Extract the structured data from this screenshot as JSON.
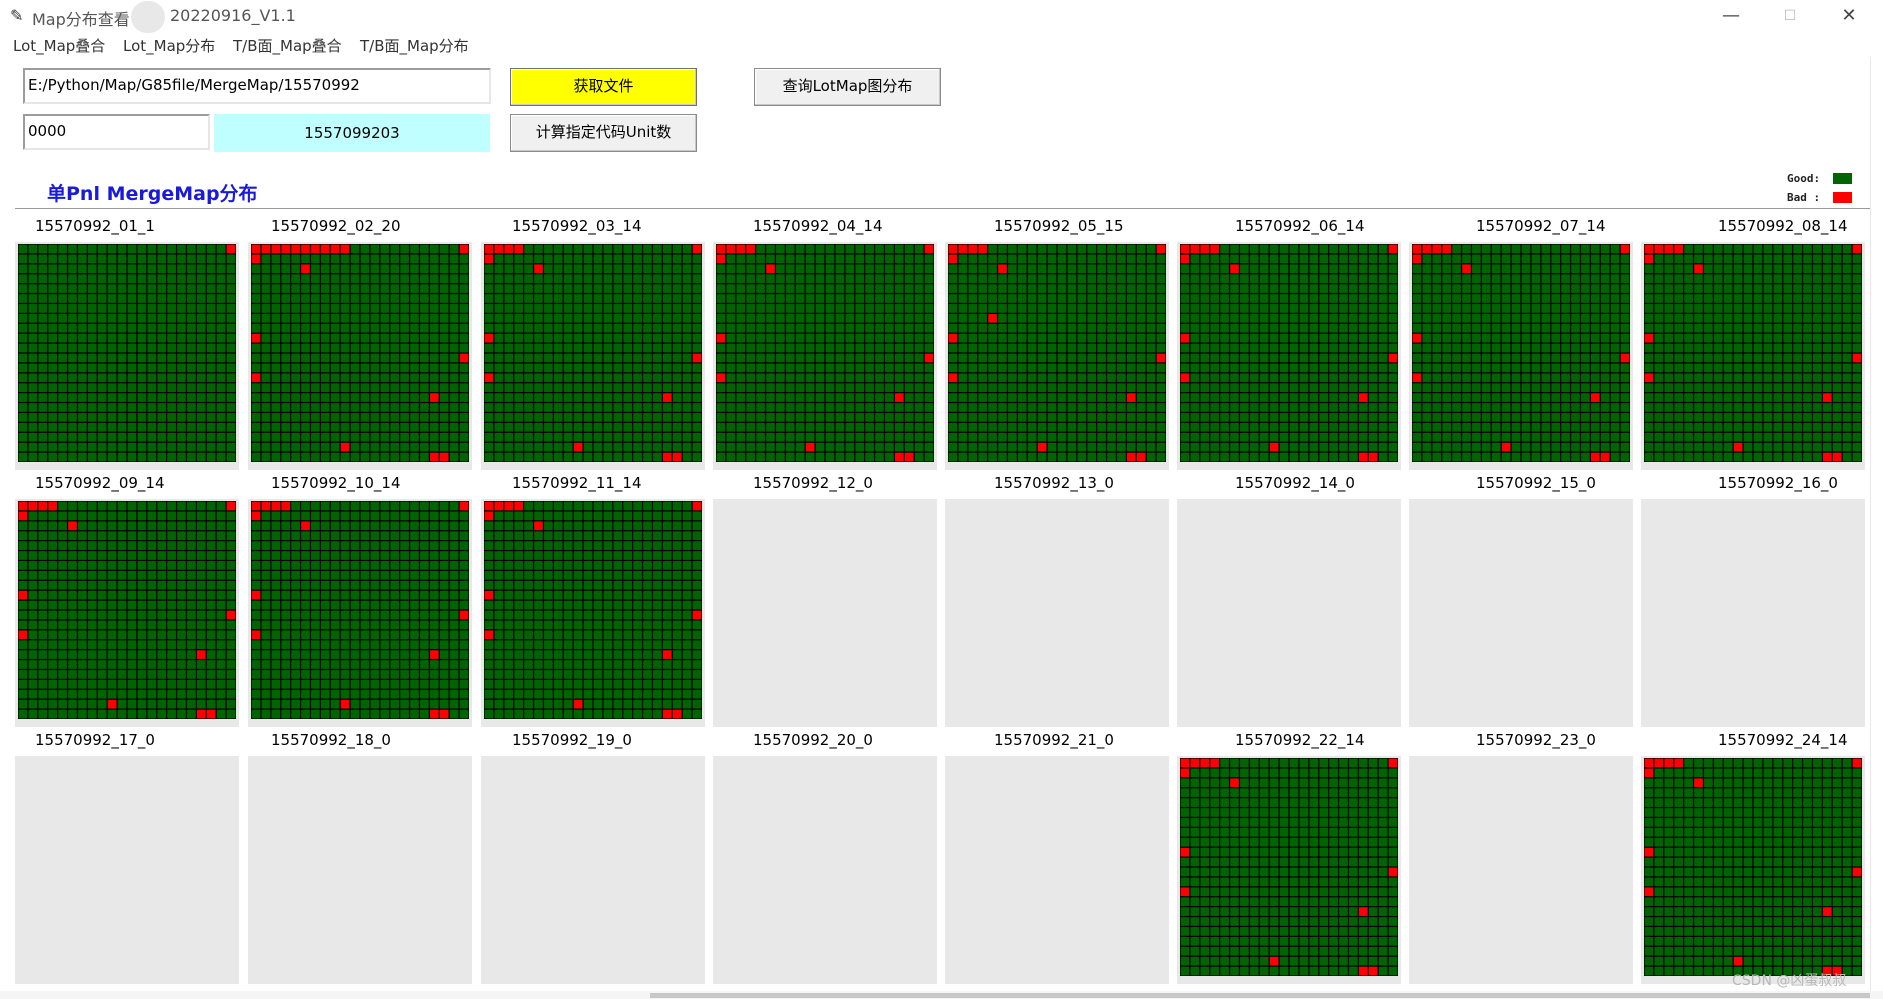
{
  "window": {
    "title_prefix": "Map分布查看",
    "title_suffix": "20220916_V1.1",
    "minimize": "—",
    "maximize": "☐",
    "close": "✕"
  },
  "menu": [
    "Lot_Map叠合",
    "Lot_Map分布",
    "T/B面_Map叠合",
    "T/B面_Map分布"
  ],
  "controls": {
    "path_value": "E:/Python/Map/G85file/MergeMap/15570992",
    "get_file_button": "获取文件",
    "query_button": "查询LotMap图分布",
    "code_value": "0000",
    "result_display": "1557099203",
    "count_button": "计算指定代码Unit数"
  },
  "section_title": "单Pnl MergeMap分布",
  "legend": {
    "good_label": "Good:",
    "bad_label": "Bad :",
    "good_color": "#006400",
    "bad_color": "#ff0000"
  },
  "grid_size": 22,
  "panels": [
    {
      "label": "15570992_01_1",
      "bad": [
        [
          0,
          21
        ]
      ]
    },
    {
      "label": "15570992_02_20",
      "bad": [
        [
          0,
          0
        ],
        [
          0,
          1
        ],
        [
          0,
          2
        ],
        [
          0,
          3
        ],
        [
          0,
          4
        ],
        [
          0,
          5
        ],
        [
          0,
          6
        ],
        [
          0,
          7
        ],
        [
          0,
          8
        ],
        [
          0,
          9
        ],
        [
          0,
          21
        ],
        [
          1,
          0
        ],
        [
          2,
          5
        ],
        [
          9,
          0
        ],
        [
          11,
          21
        ],
        [
          13,
          0
        ],
        [
          15,
          18
        ],
        [
          20,
          9
        ],
        [
          21,
          18
        ],
        [
          21,
          19
        ]
      ]
    },
    {
      "label": "15570992_03_14",
      "bad": [
        [
          0,
          0
        ],
        [
          0,
          1
        ],
        [
          0,
          2
        ],
        [
          0,
          3
        ],
        [
          0,
          21
        ],
        [
          2,
          5
        ],
        [
          9,
          0
        ],
        [
          11,
          21
        ],
        [
          13,
          0
        ],
        [
          15,
          18
        ],
        [
          20,
          9
        ],
        [
          21,
          18
        ],
        [
          21,
          19
        ],
        [
          1,
          0
        ]
      ]
    },
    {
      "label": "15570992_04_14",
      "bad": [
        [
          0,
          0
        ],
        [
          0,
          1
        ],
        [
          0,
          2
        ],
        [
          0,
          3
        ],
        [
          0,
          21
        ],
        [
          1,
          0
        ],
        [
          2,
          5
        ],
        [
          9,
          0
        ],
        [
          11,
          21
        ],
        [
          13,
          0
        ],
        [
          15,
          18
        ],
        [
          20,
          9
        ],
        [
          21,
          18
        ],
        [
          21,
          19
        ]
      ]
    },
    {
      "label": "15570992_05_15",
      "bad": [
        [
          0,
          0
        ],
        [
          0,
          1
        ],
        [
          0,
          2
        ],
        [
          0,
          3
        ],
        [
          0,
          21
        ],
        [
          1,
          0
        ],
        [
          2,
          5
        ],
        [
          7,
          4
        ],
        [
          9,
          0
        ],
        [
          11,
          21
        ],
        [
          13,
          0
        ],
        [
          15,
          18
        ],
        [
          20,
          9
        ],
        [
          21,
          18
        ],
        [
          21,
          19
        ]
      ]
    },
    {
      "label": "15570992_06_14",
      "bad": [
        [
          0,
          0
        ],
        [
          0,
          1
        ],
        [
          0,
          2
        ],
        [
          0,
          3
        ],
        [
          0,
          21
        ],
        [
          1,
          0
        ],
        [
          2,
          5
        ],
        [
          9,
          0
        ],
        [
          11,
          21
        ],
        [
          13,
          0
        ],
        [
          15,
          18
        ],
        [
          20,
          9
        ],
        [
          21,
          18
        ],
        [
          21,
          19
        ]
      ]
    },
    {
      "label": "15570992_07_14",
      "bad": [
        [
          0,
          0
        ],
        [
          0,
          1
        ],
        [
          0,
          2
        ],
        [
          0,
          3
        ],
        [
          0,
          21
        ],
        [
          1,
          0
        ],
        [
          2,
          5
        ],
        [
          9,
          0
        ],
        [
          11,
          21
        ],
        [
          13,
          0
        ],
        [
          15,
          18
        ],
        [
          20,
          9
        ],
        [
          21,
          18
        ],
        [
          21,
          19
        ]
      ]
    },
    {
      "label": "15570992_08_14",
      "bad": [
        [
          0,
          0
        ],
        [
          0,
          1
        ],
        [
          0,
          2
        ],
        [
          0,
          3
        ],
        [
          0,
          21
        ],
        [
          1,
          0
        ],
        [
          2,
          5
        ],
        [
          9,
          0
        ],
        [
          11,
          21
        ],
        [
          13,
          0
        ],
        [
          15,
          18
        ],
        [
          20,
          9
        ],
        [
          21,
          18
        ],
        [
          21,
          19
        ]
      ]
    },
    {
      "label": "15570992_09_14",
      "bad": [
        [
          0,
          0
        ],
        [
          0,
          1
        ],
        [
          0,
          2
        ],
        [
          0,
          3
        ],
        [
          0,
          21
        ],
        [
          1,
          0
        ],
        [
          2,
          5
        ],
        [
          9,
          0
        ],
        [
          11,
          21
        ],
        [
          13,
          0
        ],
        [
          15,
          18
        ],
        [
          20,
          9
        ],
        [
          21,
          18
        ],
        [
          21,
          19
        ]
      ]
    },
    {
      "label": "15570992_10_14",
      "bad": [
        [
          0,
          0
        ],
        [
          0,
          1
        ],
        [
          0,
          2
        ],
        [
          0,
          3
        ],
        [
          0,
          21
        ],
        [
          1,
          0
        ],
        [
          2,
          5
        ],
        [
          9,
          0
        ],
        [
          11,
          21
        ],
        [
          13,
          0
        ],
        [
          15,
          18
        ],
        [
          20,
          9
        ],
        [
          21,
          18
        ],
        [
          21,
          19
        ]
      ]
    },
    {
      "label": "15570992_11_14",
      "bad": [
        [
          0,
          0
        ],
        [
          0,
          1
        ],
        [
          0,
          2
        ],
        [
          0,
          3
        ],
        [
          0,
          21
        ],
        [
          1,
          0
        ],
        [
          2,
          5
        ],
        [
          9,
          0
        ],
        [
          11,
          21
        ],
        [
          13,
          0
        ],
        [
          15,
          18
        ],
        [
          20,
          9
        ],
        [
          21,
          18
        ],
        [
          21,
          19
        ]
      ]
    },
    {
      "label": "15570992_12_0",
      "bad": null
    },
    {
      "label": "15570992_13_0",
      "bad": null
    },
    {
      "label": "15570992_14_0",
      "bad": null
    },
    {
      "label": "15570992_15_0",
      "bad": null
    },
    {
      "label": "15570992_16_0",
      "bad": null
    },
    {
      "label": "15570992_17_0",
      "bad": null
    },
    {
      "label": "15570992_18_0",
      "bad": null
    },
    {
      "label": "15570992_19_0",
      "bad": null
    },
    {
      "label": "15570992_20_0",
      "bad": null
    },
    {
      "label": "15570992_21_0",
      "bad": null
    },
    {
      "label": "15570992_22_14",
      "bad": [
        [
          0,
          0
        ],
        [
          0,
          1
        ],
        [
          0,
          2
        ],
        [
          0,
          3
        ],
        [
          0,
          21
        ],
        [
          1,
          0
        ],
        [
          2,
          5
        ],
        [
          9,
          0
        ],
        [
          11,
          21
        ],
        [
          13,
          0
        ],
        [
          15,
          18
        ],
        [
          20,
          9
        ],
        [
          21,
          18
        ],
        [
          21,
          19
        ]
      ]
    },
    {
      "label": "15570992_23_0",
      "bad": null
    },
    {
      "label": "15570992_24_14",
      "bad": [
        [
          0,
          0
        ],
        [
          0,
          1
        ],
        [
          0,
          2
        ],
        [
          0,
          3
        ],
        [
          0,
          21
        ],
        [
          1,
          0
        ],
        [
          2,
          5
        ],
        [
          9,
          0
        ],
        [
          11,
          21
        ],
        [
          13,
          0
        ],
        [
          15,
          18
        ],
        [
          20,
          9
        ],
        [
          21,
          18
        ],
        [
          21,
          19
        ]
      ]
    }
  ],
  "watermark": "CSDN @凶蛋叔叔"
}
